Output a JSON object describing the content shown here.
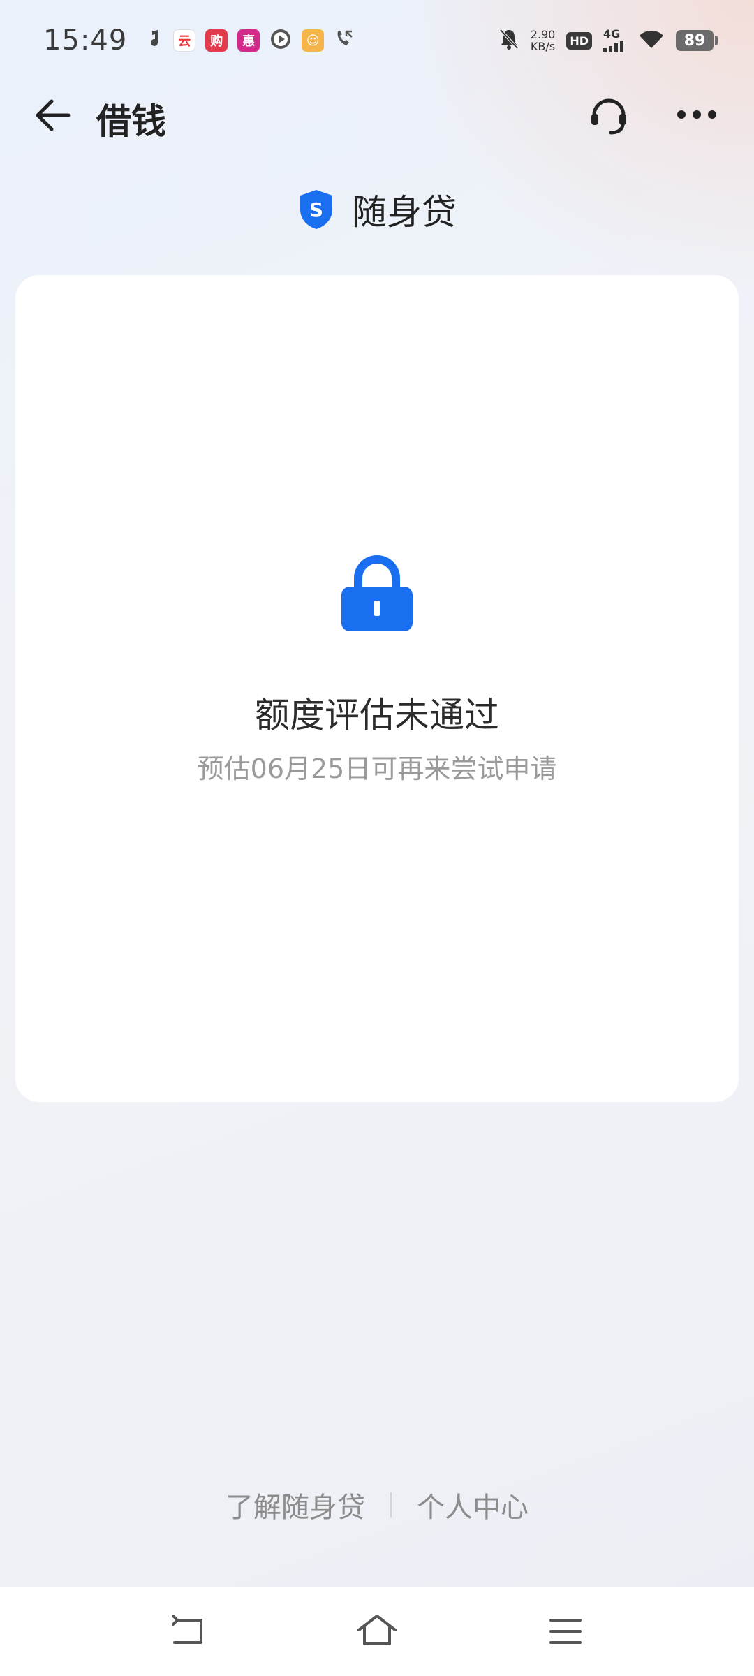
{
  "status_bar": {
    "time": "15:49",
    "network_speed_value": "2.90",
    "network_speed_unit": "KB/s",
    "hd_label": "HD",
    "network_type": "4G",
    "battery_level": "89"
  },
  "nav": {
    "title": "借钱",
    "icons": [
      "back-arrow-icon",
      "customer-service-icon",
      "more-icon"
    ]
  },
  "product": {
    "logo_letter": "S",
    "name": "随身贷",
    "logo_color": "#1a6ff0"
  },
  "result_card": {
    "icon": "lock-icon",
    "title": "额度评估未通过",
    "subtitle": "预估06月25日可再来尝试申请",
    "accent_color": "#1a6ff0"
  },
  "footer": {
    "link_about": "了解随身贷",
    "link_personal_center": "个人中心"
  },
  "system_nav": {
    "icons": [
      "back-icon",
      "home-icon",
      "menu-icon"
    ]
  }
}
